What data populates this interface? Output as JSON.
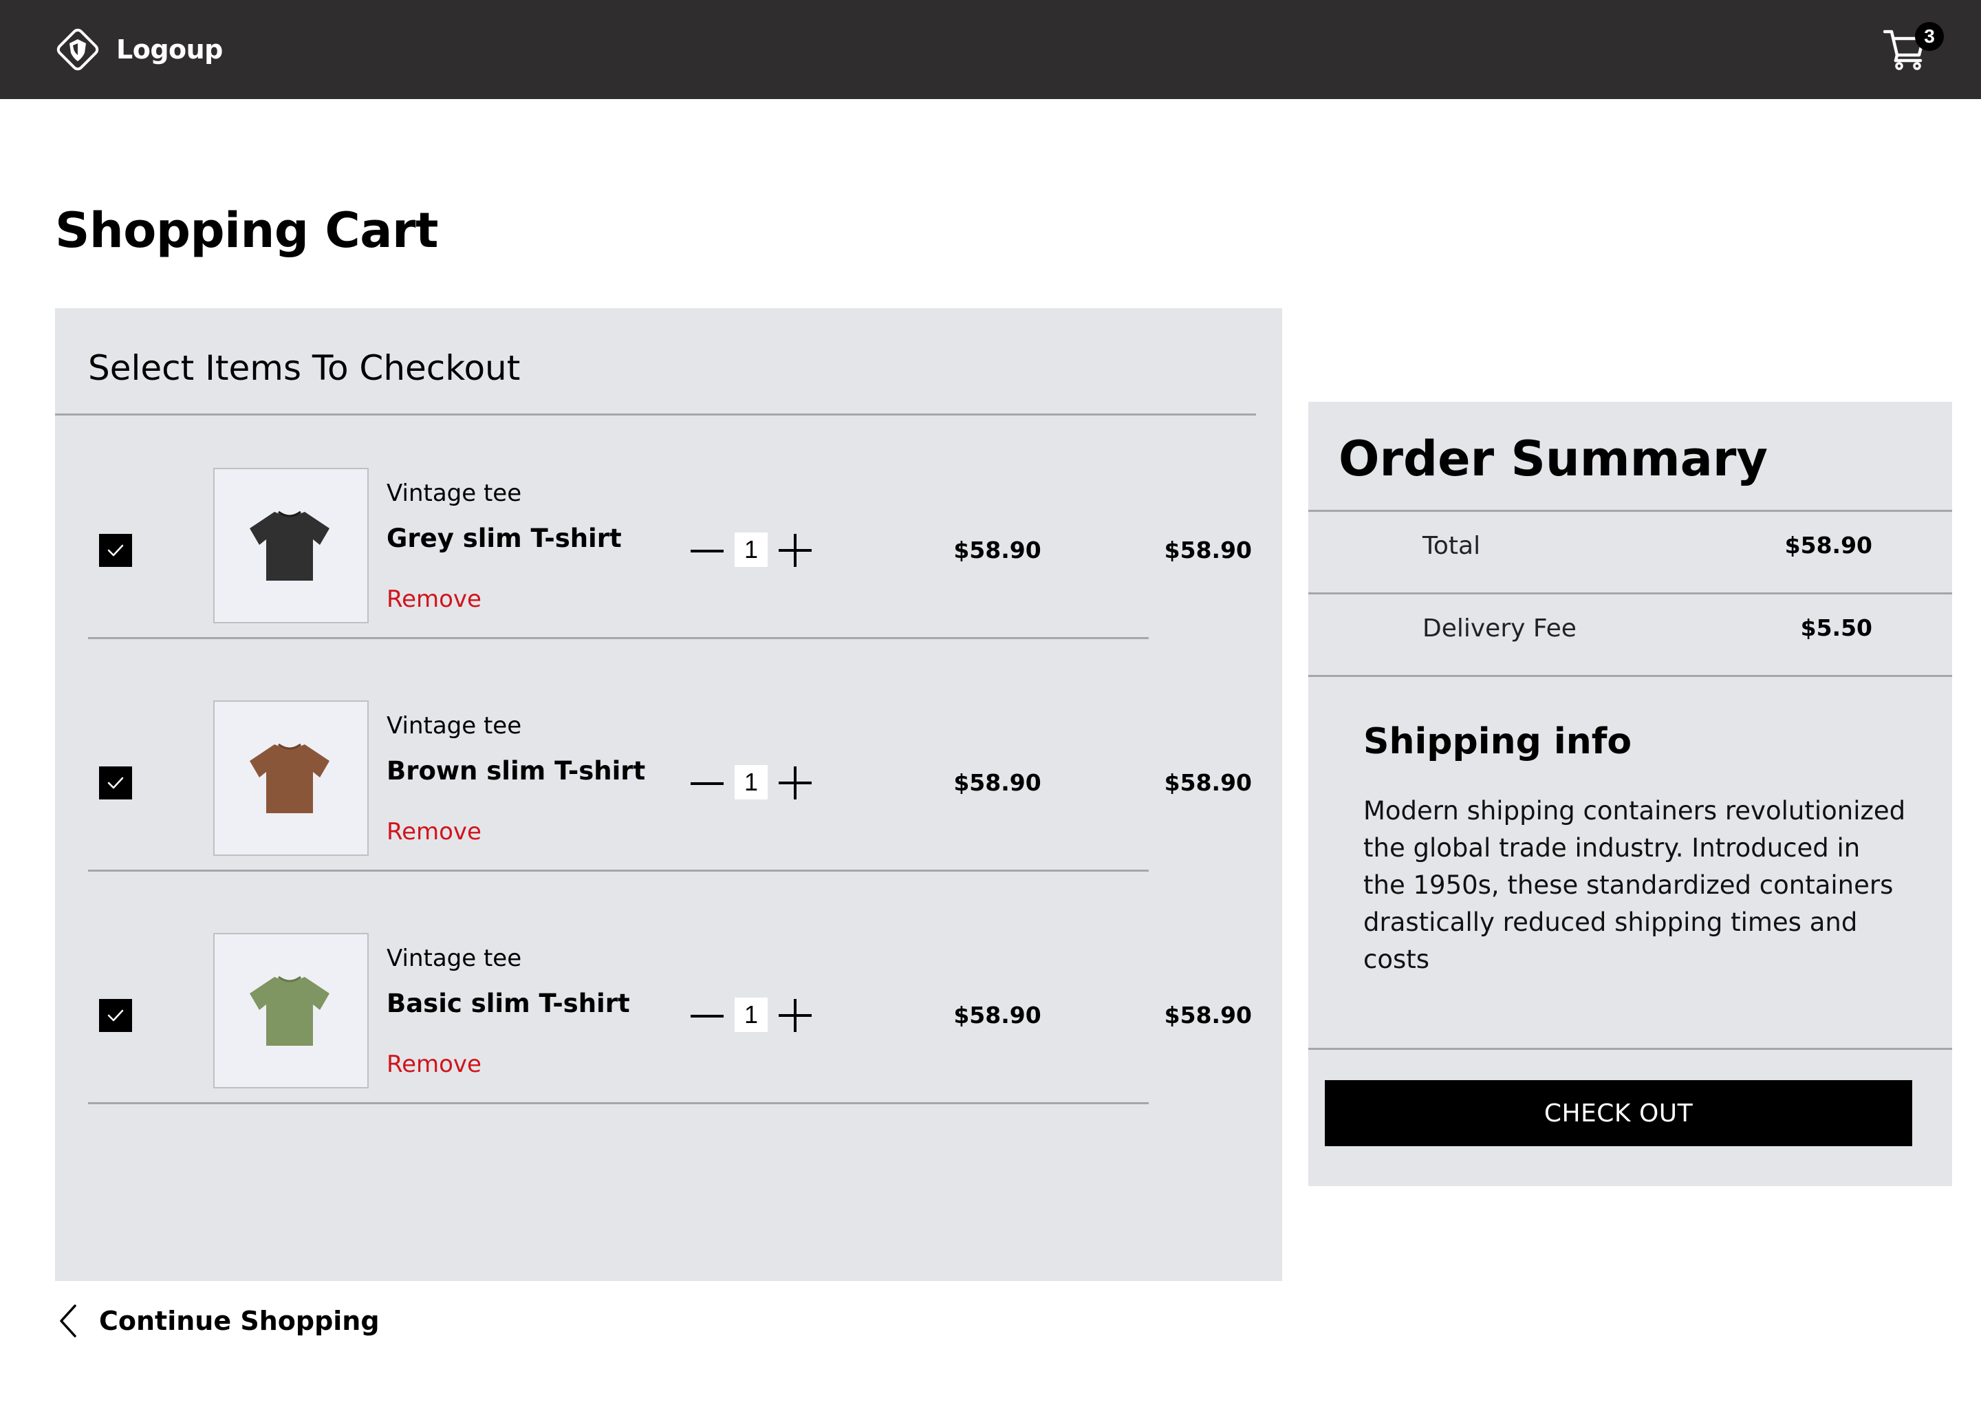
{
  "brand": {
    "name": "Logoup",
    "logo_icon": "shield-diamond-icon"
  },
  "header": {
    "cart_icon": "shopping-cart-icon",
    "cart_count": "3"
  },
  "page_title": "Shopping Cart",
  "cart": {
    "heading": "Select Items To Checkout",
    "items": [
      {
        "subtitle": "Vintage tee",
        "name": "Grey slim T-shirt",
        "remove_label": "Remove",
        "quantity": "1",
        "unit_price": "$58.90",
        "line_total": "$58.90",
        "checked": true,
        "image_icon": "grey-tshirt-icon",
        "shirt_color": "#2f302f"
      },
      {
        "subtitle": "Vintage tee",
        "name": "Brown slim T-shirt",
        "remove_label": "Remove",
        "quantity": "1",
        "unit_price": "$58.90",
        "line_total": "$58.90",
        "checked": true,
        "image_icon": "brown-tshirt-icon",
        "shirt_color": "#8a563a"
      },
      {
        "subtitle": "Vintage tee",
        "name": "Basic slim T-shirt",
        "remove_label": "Remove",
        "quantity": "1",
        "unit_price": "$58.90",
        "line_total": "$58.90",
        "checked": true,
        "image_icon": "green-tshirt-icon",
        "shirt_color": "#7f9562"
      }
    ]
  },
  "continue_shopping": {
    "label": "Continue Shopping",
    "icon": "chevron-left-icon"
  },
  "summary": {
    "title": "Order Summary",
    "total_label": "Total",
    "total_value": "$58.90",
    "fee_label": "Delivery Fee",
    "fee_value": "$5.50",
    "shipping_title": "Shipping info",
    "shipping_text": "Modern shipping containers revolutionized the global trade industry. Introduced in the 1950s, these standardized containers drastically reduced shipping times and costs",
    "checkout_label": "CHECK OUT"
  },
  "colors": {
    "header_bg": "#2f2d2e",
    "panel_bg": "#e4e5e9",
    "remove_red": "#d0141c",
    "button_bg": "#000000"
  }
}
